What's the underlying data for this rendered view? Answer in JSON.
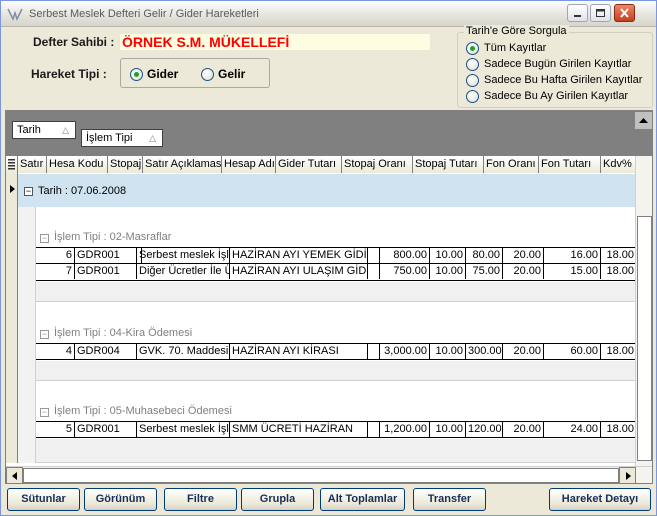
{
  "window": {
    "title": "Serbest Meslek Defteri Gelir / Gider Hareketleri"
  },
  "header": {
    "owner_label": "Defter Sahibi :",
    "owner_value": "ÖRNEK S.M. MÜKELLEFİ",
    "movement_type_label": "Hareket Tipi :",
    "movement_options": [
      {
        "label": "Gider",
        "checked": true
      },
      {
        "label": "Gelir",
        "checked": false
      }
    ]
  },
  "date_filter": {
    "title": "Tarih'e Göre Sorgula",
    "options": [
      {
        "label": "Tüm Kayıtlar",
        "checked": true
      },
      {
        "label": "Sadece Bugün Girilen Kayıtlar",
        "checked": false
      },
      {
        "label": "Sadece Bu Hafta Girilen Kayıtlar",
        "checked": false
      },
      {
        "label": "Sadece Bu Ay Girilen Kayıtlar",
        "checked": false
      }
    ]
  },
  "grouping": {
    "chips": [
      {
        "label": "Tarih",
        "arrow": "△"
      },
      {
        "label": "İşlem Tipi",
        "arrow": "△"
      }
    ]
  },
  "grid": {
    "columns": [
      "Satır",
      "Hesa Kodu",
      "Stopaj",
      "Satır Açıklaması",
      "Hesap Adı",
      "Gider Tutarı",
      "Stopaj Oranı",
      "Stopaj Tutarı",
      "Fon Oranı",
      "Fon Tutarı",
      "Kdv%"
    ],
    "date_group": "Tarih : 07.06.2008",
    "groups": [
      {
        "label": "İşlem Tipi : 02-Masraflar",
        "rows": [
          {
            "satir": "6",
            "kod": "GDR001",
            "stopaj": "",
            "aciklama": "Serbest meslek İşle",
            "hesap": "HAZİRAN AYI YEMEK GİDİ",
            "gider": "800.00",
            "stopaj_orani": "10.00",
            "stopaj_tutari": "80.00",
            "fon_orani": "20.00",
            "fon_tutari": "16.00",
            "kdv": "18.00"
          },
          {
            "satir": "7",
            "kod": "GDR001",
            "stopaj": "",
            "aciklama": "Diğer Ücretler İle Ü",
            "hesap": "HAZİRAN AYI ULAŞIM GİD",
            "gider": "750.00",
            "stopaj_orani": "10.00",
            "stopaj_tutari": "75.00",
            "fon_orani": "20.00",
            "fon_tutari": "15.00",
            "kdv": "18.00"
          }
        ]
      },
      {
        "label": "İşlem Tipi : 04-Kira Ödemesi",
        "rows": [
          {
            "satir": "4",
            "kod": "GDR004",
            "stopaj": "",
            "aciklama": "GVK. 70. Maddesin",
            "hesap": "HAZİRAN AYI KİRASI",
            "gider": "3,000.00",
            "stopaj_orani": "10.00",
            "stopaj_tutari": "300.00",
            "fon_orani": "20.00",
            "fon_tutari": "60.00",
            "kdv": "18.00"
          }
        ]
      },
      {
        "label": "İşlem Tipi : 05-Muhasebeci Ödemesi",
        "rows": [
          {
            "satir": "5",
            "kod": "GDR001",
            "stopaj": "",
            "aciklama": "Serbest meslek İşle",
            "hesap": "SMM ÜCRETİ HAZİRAN",
            "gider": "1,200.00",
            "stopaj_orani": "10.00",
            "stopaj_tutari": "120.00",
            "fon_orani": "20.00",
            "fon_tutari": "24.00",
            "kdv": "18.00"
          }
        ]
      }
    ]
  },
  "footer": {
    "buttons": [
      "Sütunlar",
      "Görünüm",
      "Filtre",
      "Grupla",
      "Alt Toplamlar",
      "Transfer"
    ],
    "detail_button": "Hareket Detayı"
  }
}
